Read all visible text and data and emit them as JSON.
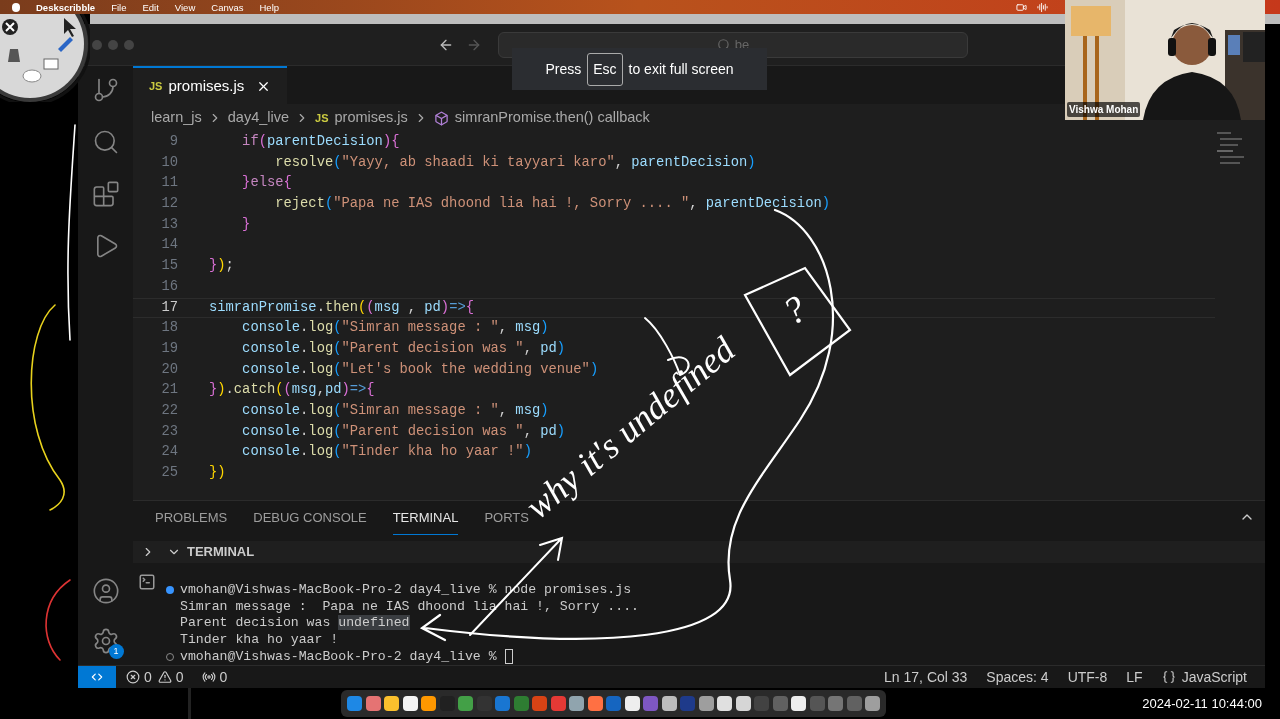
{
  "menu_bar": {
    "app": "Deskscribble",
    "items": [
      "File",
      "Edit",
      "View",
      "Canvas",
      "Help"
    ]
  },
  "fullscreen_hint": {
    "before": "Press",
    "key": "Esc",
    "after": "to exit full screen"
  },
  "webcam": {
    "name": "Vishwa Mohan"
  },
  "title_bar": {
    "search": {
      "value": "be"
    }
  },
  "activity_bar": {
    "manage_badge": "1"
  },
  "tabs": [
    {
      "icon": "JS",
      "label": "promises.js",
      "selected": true
    }
  ],
  "breadcrumb": [
    {
      "kind": "folder",
      "label": "learn_js"
    },
    {
      "kind": "folder",
      "label": "day4_live"
    },
    {
      "kind": "file",
      "badge": "JS",
      "label": "promises.js"
    },
    {
      "kind": "symbol",
      "label": "simranPromise.then() callback"
    }
  ],
  "code": [
    {
      "number": "9",
      "current": false,
      "tokens": [
        {
          "kind": "kw",
          "text": "    if"
        },
        {
          "kind": "b2",
          "text": "("
        },
        {
          "kind": "var",
          "text": "parentDecision"
        },
        {
          "kind": "b2",
          "text": "){"
        }
      ]
    },
    {
      "number": "10",
      "current": false,
      "tokens": [
        {
          "kind": "fn",
          "text": "        resolve"
        },
        {
          "kind": "b3",
          "text": "("
        },
        {
          "kind": "str",
          "text": "\"Yayy, ab shaadi ki tayyari karo\""
        },
        {
          "kind": "plain",
          "text": ", "
        },
        {
          "kind": "var",
          "text": "parentDecision"
        },
        {
          "kind": "b3",
          "text": ")"
        }
      ]
    },
    {
      "number": "11",
      "current": false,
      "tokens": [
        {
          "kind": "b2",
          "text": "    }"
        },
        {
          "kind": "kw",
          "text": "else"
        },
        {
          "kind": "b2",
          "text": "{"
        }
      ]
    },
    {
      "number": "12",
      "current": false,
      "tokens": [
        {
          "kind": "fn",
          "text": "        reject"
        },
        {
          "kind": "b3",
          "text": "("
        },
        {
          "kind": "str",
          "text": "\"Papa ne IAS dhoond lia hai !, Sorry .... \""
        },
        {
          "kind": "plain",
          "text": ", "
        },
        {
          "kind": "var",
          "text": "parentDecision"
        },
        {
          "kind": "b3",
          "text": ")"
        }
      ]
    },
    {
      "number": "13",
      "current": false,
      "tokens": [
        {
          "kind": "b2",
          "text": "    }"
        }
      ]
    },
    {
      "number": "14",
      "current": false
    },
    {
      "number": "15",
      "current": false,
      "tokens": [
        {
          "kind": "b2",
          "text": "}"
        },
        {
          "kind": "b1",
          "text": ")"
        },
        {
          "kind": "plain",
          "text": ";"
        }
      ]
    },
    {
      "number": "16",
      "current": false
    },
    {
      "number": "17",
      "current": true,
      "tokens": [
        {
          "kind": "var",
          "text": "simranPromise"
        },
        {
          "kind": "plain",
          "text": "."
        },
        {
          "kind": "fn",
          "text": "then"
        },
        {
          "kind": "b1",
          "text": "("
        },
        {
          "kind": "b2",
          "text": "("
        },
        {
          "kind": "var",
          "text": "msg"
        },
        {
          "kind": "plain",
          "text": " , "
        },
        {
          "kind": "var",
          "text": "pd"
        },
        {
          "kind": "b2",
          "text": ")"
        },
        {
          "kind": "op",
          "text": "=>"
        },
        {
          "kind": "b2",
          "text": "{"
        }
      ]
    },
    {
      "number": "18",
      "current": false,
      "tokens": [
        {
          "kind": "var",
          "text": "    console"
        },
        {
          "kind": "plain",
          "text": "."
        },
        {
          "kind": "fn",
          "text": "log"
        },
        {
          "kind": "b3",
          "text": "("
        },
        {
          "kind": "str",
          "text": "\"Simran message : \""
        },
        {
          "kind": "plain",
          "text": ", "
        },
        {
          "kind": "var",
          "text": "msg"
        },
        {
          "kind": "b3",
          "text": ")"
        }
      ]
    },
    {
      "number": "19",
      "current": false,
      "tokens": [
        {
          "kind": "var",
          "text": "    console"
        },
        {
          "kind": "plain",
          "text": "."
        },
        {
          "kind": "fn",
          "text": "log"
        },
        {
          "kind": "b3",
          "text": "("
        },
        {
          "kind": "str",
          "text": "\"Parent decision was \""
        },
        {
          "kind": "plain",
          "text": ", "
        },
        {
          "kind": "var",
          "text": "pd"
        },
        {
          "kind": "b3",
          "text": ")"
        }
      ]
    },
    {
      "number": "20",
      "current": false,
      "tokens": [
        {
          "kind": "var",
          "text": "    console"
        },
        {
          "kind": "plain",
          "text": "."
        },
        {
          "kind": "fn",
          "text": "log"
        },
        {
          "kind": "b3",
          "text": "("
        },
        {
          "kind": "str",
          "text": "\"Let's book the wedding venue\""
        },
        {
          "kind": "b3",
          "text": ")"
        }
      ]
    },
    {
      "number": "21",
      "current": false,
      "tokens": [
        {
          "kind": "b2",
          "text": "}"
        },
        {
          "kind": "b1",
          "text": ")"
        },
        {
          "kind": "plain",
          "text": "."
        },
        {
          "kind": "fn",
          "text": "catch"
        },
        {
          "kind": "b1",
          "text": "("
        },
        {
          "kind": "b2",
          "text": "("
        },
        {
          "kind": "var",
          "text": "msg"
        },
        {
          "kind": "plain",
          "text": ","
        },
        {
          "kind": "var",
          "text": "pd"
        },
        {
          "kind": "b2",
          "text": ")"
        },
        {
          "kind": "op",
          "text": "=>"
        },
        {
          "kind": "b2",
          "text": "{"
        }
      ]
    },
    {
      "number": "22",
      "current": false,
      "tokens": [
        {
          "kind": "var",
          "text": "    console"
        },
        {
          "kind": "plain",
          "text": "."
        },
        {
          "kind": "fn",
          "text": "log"
        },
        {
          "kind": "b3",
          "text": "("
        },
        {
          "kind": "str",
          "text": "\"Simran message : \""
        },
        {
          "kind": "plain",
          "text": ", "
        },
        {
          "kind": "var",
          "text": "msg"
        },
        {
          "kind": "b3",
          "text": ")"
        }
      ]
    },
    {
      "number": "23",
      "current": false,
      "tokens": [
        {
          "kind": "var",
          "text": "    console"
        },
        {
          "kind": "plain",
          "text": "."
        },
        {
          "kind": "fn",
          "text": "log"
        },
        {
          "kind": "b3",
          "text": "("
        },
        {
          "kind": "str",
          "text": "\"Parent decision was \""
        },
        {
          "kind": "plain",
          "text": ", "
        },
        {
          "kind": "var",
          "text": "pd"
        },
        {
          "kind": "b3",
          "text": ")"
        }
      ]
    },
    {
      "number": "24",
      "current": false,
      "tokens": [
        {
          "kind": "var",
          "text": "    console"
        },
        {
          "kind": "plain",
          "text": "."
        },
        {
          "kind": "fn",
          "text": "log"
        },
        {
          "kind": "b3",
          "text": "("
        },
        {
          "kind": "str",
          "text": "\"Tinder kha ho yaar !\""
        },
        {
          "kind": "b3",
          "text": ")"
        }
      ]
    },
    {
      "number": "25",
      "current": false,
      "tokens": [
        {
          "kind": "b1",
          "text": "})"
        }
      ]
    }
  ],
  "panel": {
    "tabs": [
      {
        "label": "PROBLEMS",
        "selected": false
      },
      {
        "label": "DEBUG CONSOLE",
        "selected": false
      },
      {
        "label": "TERMINAL",
        "selected": true
      },
      {
        "label": "PORTS",
        "selected": false
      }
    ],
    "terminal_title": "TERMINAL",
    "lines": [
      {
        "kind": "command",
        "finished": true,
        "cursor": false,
        "segments": [
          {
            "text": "vmohan@Vishwas-MacBook-Pro-2 day4_live % node promises.js",
            "highlight": false
          }
        ]
      },
      {
        "kind": "output",
        "cursor": false,
        "segments": [
          {
            "text": "Simran message :  Papa ne IAS dhoond lia hai !, Sorry ....",
            "highlight": false
          }
        ]
      },
      {
        "kind": "output",
        "cursor": false,
        "segments": [
          {
            "text": "Parent decision was ",
            "highlight": false
          },
          {
            "text": "undefined",
            "highlight": true
          }
        ]
      },
      {
        "kind": "output",
        "cursor": false,
        "segments": [
          {
            "text": "Tinder kha ho yaar !",
            "highlight": false
          }
        ]
      },
      {
        "kind": "command",
        "finished": false,
        "cursor": true,
        "segments": [
          {
            "text": "vmohan@Vishwas-MacBook-Pro-2 day4_live %",
            "highlight": false
          }
        ]
      }
    ]
  },
  "status_bar": {
    "errors": "0",
    "warnings": "0",
    "ports": "0",
    "items": [
      "Ln 17, Col 33",
      "Spaces: 4",
      "UTF-8",
      "LF"
    ],
    "language": "JavaScript"
  },
  "annotation": {
    "text": "why it's undefined",
    "mark": "?"
  },
  "clock": "2024-02-11 10:44:00"
}
